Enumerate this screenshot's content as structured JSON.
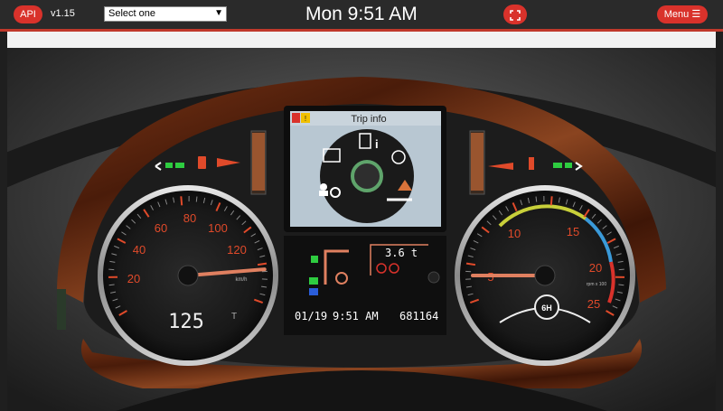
{
  "topbar": {
    "api_label": "API",
    "version": "v1.15",
    "select": {
      "selected": "Select one",
      "arrow_icon": "chevron-down-icon"
    },
    "clock": "Mon 9:51 AM",
    "fullscreen_icon": "fullscreen-icon",
    "menu_label": "Menu"
  },
  "dashboard": {
    "left_gauge": {
      "ticks": [
        "20",
        "40",
        "60",
        "80",
        "100",
        "120"
      ],
      "unit": "km/h",
      "speed": "125",
      "needle_value": 125
    },
    "right_gauge": {
      "ticks": [
        "5",
        "10",
        "15",
        "20",
        "25"
      ],
      "unit": "rpm x 100",
      "needle_value": 5,
      "gear": "6H"
    },
    "screen": {
      "title": "Trip info",
      "warning_glyph": "!",
      "weight": "3.6 t",
      "date": "01/19",
      "time": "9:51 AM",
      "odometer": "681164"
    }
  },
  "colors": {
    "accent": "#d9322b",
    "needle": "#e08060",
    "indicator_green": "#2ecc40",
    "screen_bg": "#b8c7d2",
    "lcd_text": "#ffffff"
  }
}
